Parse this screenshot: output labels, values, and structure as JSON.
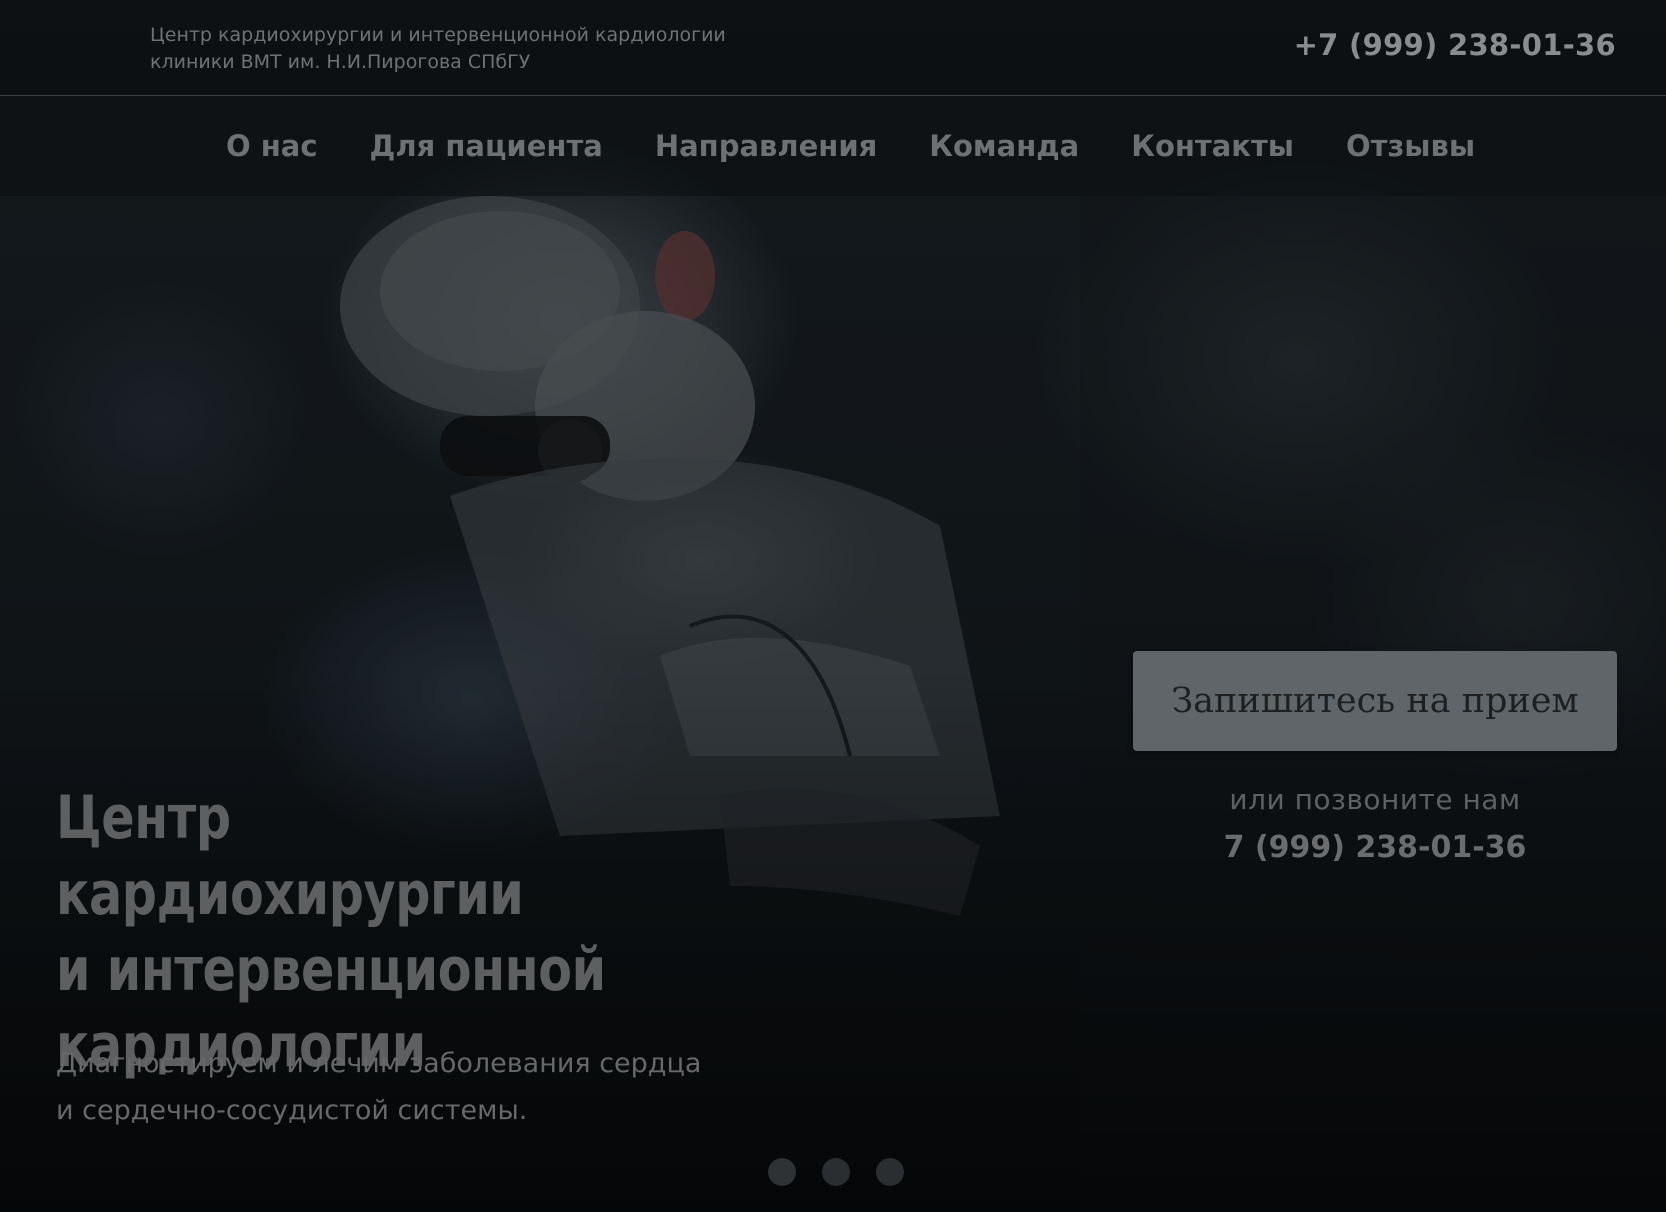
{
  "header": {
    "clinic_name_line1": "Центр кардиохирургии и интервенционной кардиологии",
    "clinic_name_line2": "клиники ВМТ им. Н.И.Пирогова СПбГУ",
    "phone": "+7 (999) 238-01-36"
  },
  "nav": {
    "items": [
      {
        "label": "О нас"
      },
      {
        "label": "Для пациента"
      },
      {
        "label": "Направления"
      },
      {
        "label": "Команда"
      },
      {
        "label": "Контакты"
      },
      {
        "label": "Отзывы"
      }
    ]
  },
  "hero": {
    "title_line1": "Центр кардиохирургии",
    "title_line2": "и интервенционной",
    "title_line3": "кардиологии",
    "subtitle_line1": "Диагностируем и лечим заболевания сердца",
    "subtitle_line2": "и сердечно-сосудистой системы.",
    "background_image": "surgeon-operating-photo"
  },
  "slider": {
    "dot_count": 3,
    "active_index": 0
  },
  "cta": {
    "button_label": "Запишитесь на прием",
    "call_text": "или позвоните нам",
    "call_phone": "7 (999) 238-01-36"
  },
  "colors": {
    "overlay": "#0b0e10",
    "cta_button": "#5f6568",
    "text_muted": "#6e7173"
  }
}
